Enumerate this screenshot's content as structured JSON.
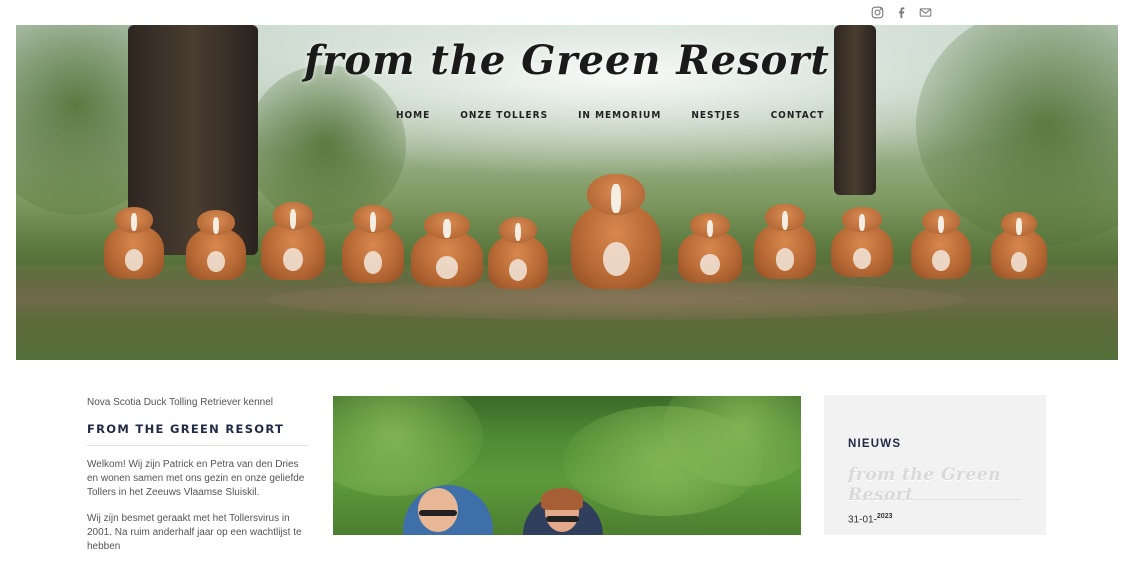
{
  "social": {
    "icons": [
      "instagram-icon",
      "facebook-icon",
      "mail-icon"
    ]
  },
  "hero": {
    "logo": "from the Green Resort",
    "nav": [
      "HOME",
      "ONZE TOLLERS",
      "IN MEMORIUM",
      "NESTJES",
      "CONTACT"
    ]
  },
  "left": {
    "tagline": "Nova Scotia Duck Tolling Retriever kennel",
    "title": "FROM THE GREEN RESORT",
    "para1": "Welkom! Wij zijn Patrick en Petra van den Dries en wonen samen met ons gezin en onze geliefde Tollers in het Zeeuws Vlaamse Sluiskil.",
    "para2": "Wij zijn besmet geraakt met het Tollersvirus in 2001. Na ruim anderhalf jaar op een wachtlijst te hebben"
  },
  "news": {
    "title": "NIEUWS",
    "logo": "from the Green Resort",
    "date": "31-01-",
    "year": "2023"
  },
  "colors": {
    "accent": "#1f2a44",
    "panel": "#f2f2f2"
  }
}
